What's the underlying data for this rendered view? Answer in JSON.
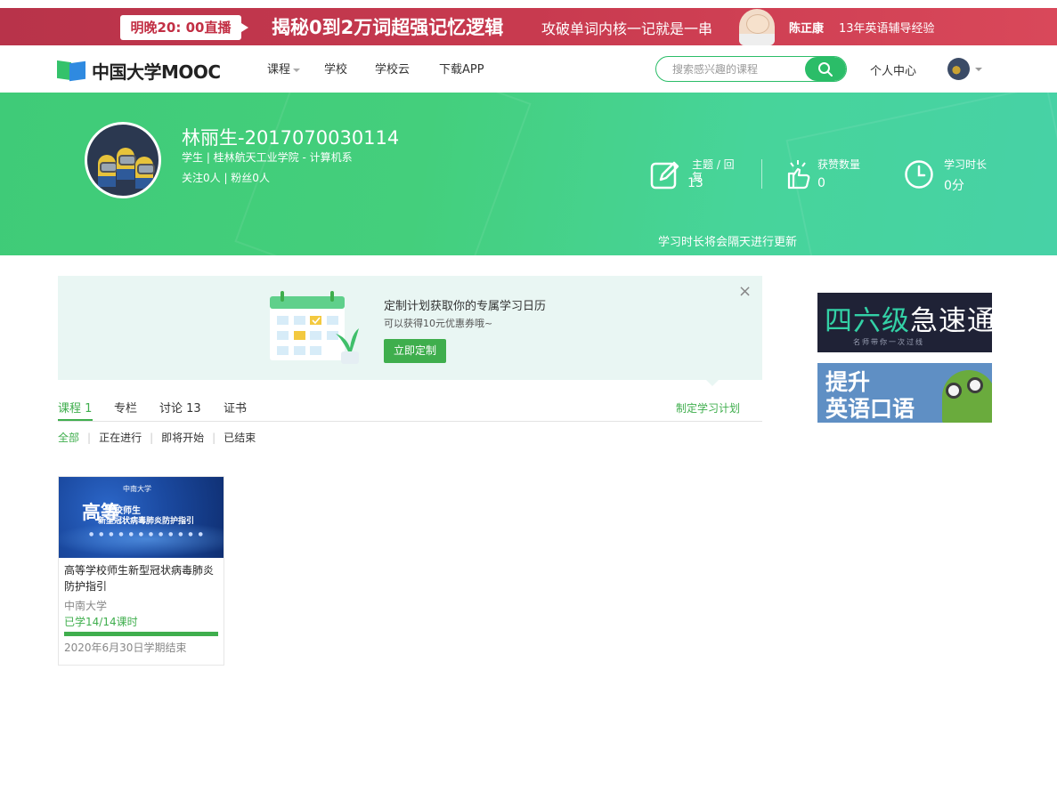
{
  "promo": {
    "live_label": "明晚20: 00直播",
    "title": "揭秘0到2万词超强记忆逻辑",
    "subtitle": "攻破单词内核一记就是一串",
    "teacher": "陈正康",
    "experience": "13年英语辅导经验"
  },
  "nav": {
    "logo_text": "中国大学MOOC",
    "items": [
      "课程",
      "学校",
      "学校云",
      "下载APP"
    ],
    "search_placeholder": "搜索感兴趣的课程",
    "personal_center": "个人中心"
  },
  "profile": {
    "name": "林丽生-2017070030114",
    "role_school": "学生 | 桂林航天工业学院 - 计算机系",
    "follow_info": "关注0人 | 粉丝0人",
    "stats": [
      {
        "label": "主题 / 回复",
        "value": "13",
        "icon": "edit-icon"
      },
      {
        "label": "获赞数量",
        "value": "0",
        "icon": "like-icon"
      },
      {
        "label": "学习时长",
        "value": "0分",
        "icon": "clock-icon"
      }
    ],
    "note": "学习时长将会隔天进行更新"
  },
  "calendar_promo": {
    "title": "定制计划获取你的专属学习日历",
    "subtitle": "可以获得10元优惠券哦~",
    "button": "立即定制",
    "close": "×"
  },
  "tabs": {
    "items": [
      "课程 1",
      "专栏",
      "讨论 13",
      "证书"
    ],
    "active": "课程 1",
    "plan_link": "制定学习计划"
  },
  "filters": [
    "全部",
    "正在进行",
    "即将开始",
    "已结束"
  ],
  "course": {
    "thumb_university": "中南大学",
    "thumb_big": "高等",
    "thumb_line1": "学校师生",
    "thumb_line2": "新型冠状病毒肺炎防护指引",
    "title": "高等学校师生新型冠状病毒肺炎防护指引",
    "school": "中南大学",
    "progress_text": "已学14/14课时",
    "progress": 1.0,
    "end_text": "2020年6月30日学期结束"
  },
  "ads": {
    "ad1_part1": "四六级",
    "ad1_part2": "急速通关",
    "ad1_sub": "名师带你一次过线",
    "ad2_line1": "提升",
    "ad2_line2": "英语口语"
  },
  "colors": {
    "brand_green": "#3fae4d",
    "hero_green": "#44cf7c",
    "promo_red": "#c83a4f"
  }
}
